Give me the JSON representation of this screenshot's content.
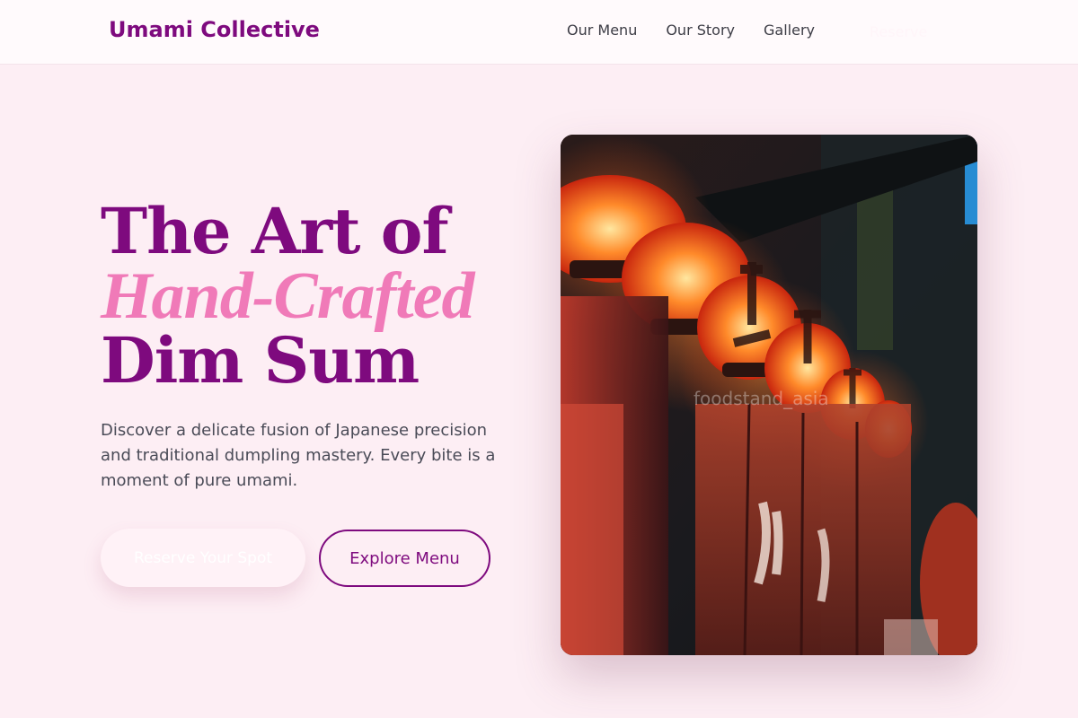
{
  "navbar": {
    "brand": "Umami Collective",
    "links": [
      "Our Menu",
      "Our Story",
      "Gallery"
    ],
    "reserve_label": "Reserve"
  },
  "hero": {
    "title_line1": "The Art of",
    "title_line2": "Hand-Crafted",
    "title_line3": "Dim Sum",
    "description": "Discover a delicate fusion of Japanese precision and traditional dumpling mastery. Every bite is a moment of pure umami.",
    "primary_button": "Reserve Your Spot",
    "secondary_button": "Explore Menu",
    "image_watermark": "foodstand_asia"
  },
  "colors": {
    "brand": "#7e0a7e",
    "accent": "#f07ab8",
    "background": "#fdeef4"
  }
}
